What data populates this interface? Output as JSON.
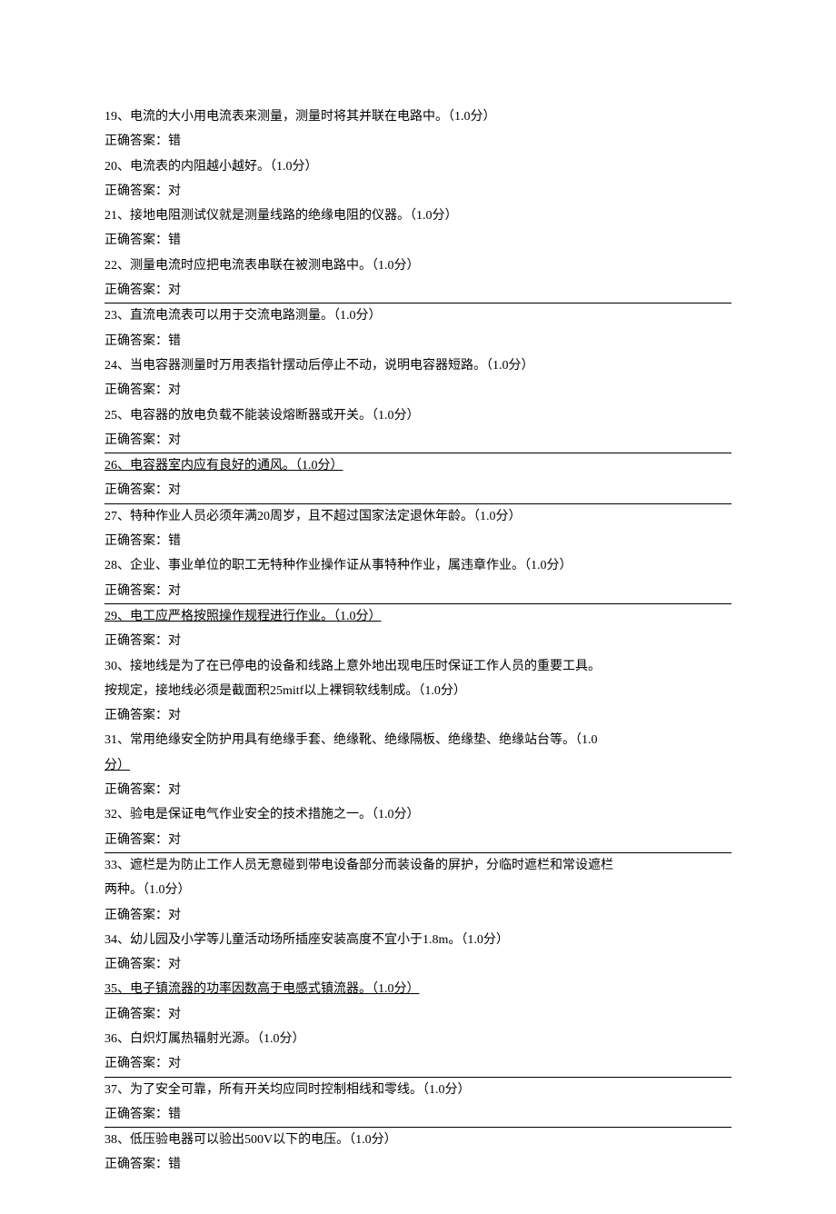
{
  "items": [
    {
      "n": "19",
      "q": "电流的大小用电流表来测量，测量时将其并联在电路中。",
      "pts": "（1.0分）",
      "ans": "错",
      "style": "none"
    },
    {
      "n": "20",
      "q": "电流表的内阻越小越好。",
      "pts": "（1.0分）",
      "ans": "对",
      "style": "none"
    },
    {
      "n": "21",
      "q": "接地电阻测试仪就是测量线路的绝缘电阻的仪器。",
      "pts": "（1.0分）",
      "ans": "错",
      "style": "none"
    },
    {
      "n": "22",
      "q": "测量电流时应把电流表串联在被测电路中。",
      "pts": "（1.0分）",
      "ans": "对",
      "style": "ansline"
    },
    {
      "n": "23",
      "q": "直流电流表可以用于交流电路测量。",
      "pts": "（1.0分）",
      "ans": "错",
      "style": "none"
    },
    {
      "n": "24",
      "q": "当电容器测量时万用表指针摆动后停止不动，说明电容器短路。",
      "pts": "（1.0分）",
      "ans": "对",
      "style": "none"
    },
    {
      "n": "25",
      "q": "电容器的放电负载不能装设熔断器或开关。",
      "pts": "（1.0分）",
      "ans": "对",
      "style": "ansline"
    },
    {
      "n": "26",
      "q": "电容器室内应有良好的通风。",
      "pts": "（1.0分）",
      "ans": "对",
      "style": "qline_ansline"
    },
    {
      "n": "27",
      "q": "特种作业人员必须年满20周岁，且不超过国家法定退休年龄。",
      "pts": "（1.0分）",
      "ans": "错",
      "style": "none"
    },
    {
      "n": "28",
      "q": "企业、事业单位的职工无特种作业操作证从事特种作业，属违章作业。",
      "pts": "（1.0分）",
      "ans": "对",
      "style": "ansline"
    },
    {
      "n": "29",
      "q": "电工应严格按照操作规程进行作业。",
      "pts": "（1.0分）",
      "ans": "对",
      "style": "qline"
    },
    {
      "n": "30",
      "q": "接地线是为了在已停电的设备和线路上意外地出现电压时保证工作人员的重要工具。",
      "q2": "按规定，接地线必须是截面积25mitf以上裸铜软线制成。",
      "pts": "（1.0分）",
      "ans": "对",
      "style": "none"
    },
    {
      "n": "31",
      "q": "常用绝缘安全防护用具有绝缘手套、绝缘靴、绝缘隔板、绝缘垫、绝缘站台等。",
      "q2b": "分）",
      "pts": "（1.0",
      "ans": "对",
      "style": "ptsline"
    },
    {
      "n": "32",
      "q": "验电是保证电气作业安全的技术措施之一。",
      "pts": "（1.0分）",
      "ans": "对",
      "style": "ansline"
    },
    {
      "n": "33",
      "q": "遮栏是为防止工作人员无意碰到带电设备部分而装设备的屏护，分临时遮栏和常设遮栏",
      "q2": "两种。",
      "pts": "（1.0分）",
      "ans": "对",
      "style": "none"
    },
    {
      "n": "34",
      "q": "幼儿园及小学等儿童活动场所插座安装高度不宜小于1.8m。",
      "pts": "（1.0分）",
      "ans": "对",
      "style": "none"
    },
    {
      "n": "35",
      "q": "电子镇流器的功率因数高于电感式镇流器。",
      "pts": "（1.0分）",
      "ans": "对",
      "style": "qline"
    },
    {
      "n": "36",
      "q": "白炽灯属热辐射光源。",
      "pts": "（1.0分）",
      "ans": "对",
      "style": "ansline"
    },
    {
      "n": "37",
      "q": "为了安全可靠，所有开关均应同时控制相线和零线。",
      "pts": "（1.0分）",
      "ans": "错",
      "style": "ansline"
    },
    {
      "n": "38",
      "q": "低压验电器可以验出500V以下的电压。",
      "pts": "（1.0分）",
      "ans": "错",
      "style": "none"
    }
  ],
  "labels": {
    "answer_prefix": "正确答案："
  }
}
